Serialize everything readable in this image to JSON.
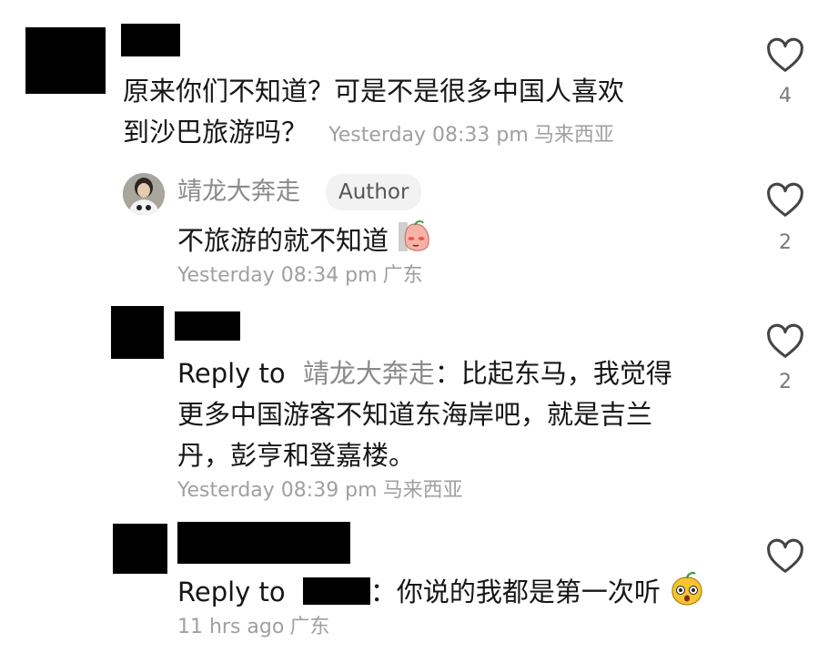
{
  "comments": [
    {
      "text_line1": "原来你们不知道？可是不是很多中国人喜欢",
      "text_line2": "到沙巴旅游吗？",
      "time": "Yesterday 08:33 pm",
      "location": "马来西亚",
      "likes": "4"
    },
    {
      "username": "靖龙大奔走",
      "badge": "Author",
      "text": "不旅游的就不知道",
      "time": "Yesterday 08:34 pm",
      "location": "广东",
      "likes": "2"
    },
    {
      "reply_prefix": "Reply to",
      "reply_target": "靖龙大奔走",
      "text_line1": "：比起东马，我觉得",
      "text_line2": "更多中国游客不知道东海岸吧，就是吉兰",
      "text_line3": "丹，彭亨和登嘉楼。",
      "time": "Yesterday 08:39 pm",
      "location": "马来西亚",
      "likes": "2"
    },
    {
      "reply_prefix": "Reply to",
      "text": "：你说的我都是第一次听",
      "time": "11 hrs ago",
      "location": "广东"
    }
  ],
  "icons": {
    "like": "heart-outline-icon",
    "sticker_1": "blushing-peach-sticker",
    "sticker_2": "surprised-face-sticker"
  }
}
